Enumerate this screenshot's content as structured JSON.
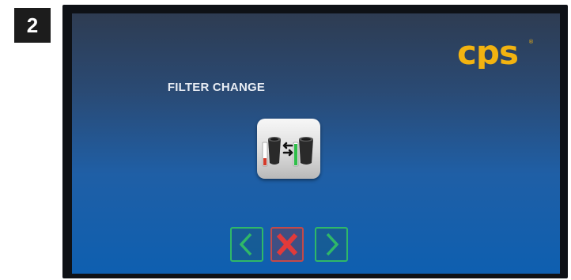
{
  "step_badge": "2",
  "brand": {
    "logo_text": "cps",
    "color": "#f2b310",
    "icon": "cps-logo"
  },
  "screen": {
    "title": "FILTER CHANGE",
    "tile_icon": "filter-change-icon"
  },
  "nav": {
    "prev_icon": "chevron-left-icon",
    "cancel_icon": "close-icon",
    "next_icon": "chevron-right-icon",
    "confirm_color": "#2fb868",
    "cancel_color": "#e23a3a"
  }
}
